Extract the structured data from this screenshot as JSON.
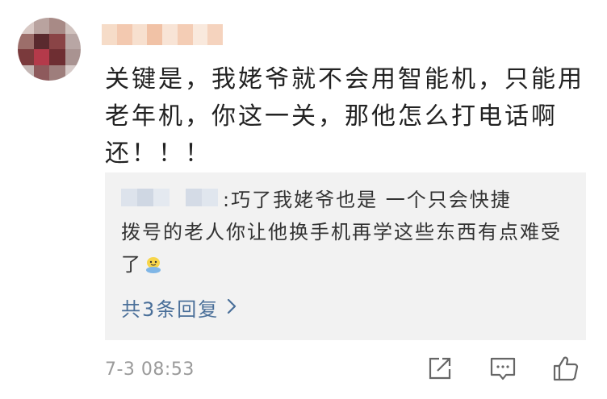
{
  "comment": {
    "text": "关键是，我姥爷就不会用智能机，只能用老年机，你这一关，那他怎么打电话啊还！！！",
    "timestamp": "7-3 08:53"
  },
  "reply": {
    "text_first": ":巧了我姥爷也是 一个只会快捷",
    "text_rest": "拨号的老人你让他换手机再学这些东西有点难受了",
    "count_label": "共3条回复"
  },
  "icons": {
    "share": "share-icon",
    "comment": "comment-icon",
    "like": "thumbs-up-icon",
    "emoji": "emoji-icon",
    "chevron": "chevron-right-icon"
  },
  "colors": {
    "text": "#222222",
    "reply_bg": "#f2f2f2",
    "link": "#4a6f99",
    "muted": "#9a9a9a"
  }
}
